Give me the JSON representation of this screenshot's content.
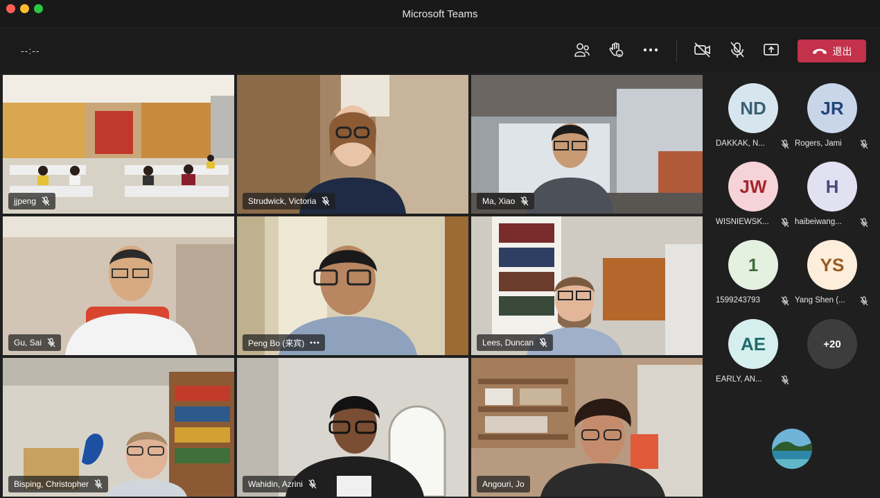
{
  "window": {
    "title": "Microsoft Teams"
  },
  "toolbar": {
    "timer": "--:--",
    "icons": [
      "people-icon",
      "raise-hand-icon",
      "more-icon",
      "camera-off-icon",
      "mic-off-icon",
      "share-screen-icon"
    ],
    "leave_label": "退出",
    "leave_color": "#c4314b"
  },
  "tiles": [
    {
      "name": "jjpeng",
      "muted": true
    },
    {
      "name": "Strudwick, Victoria",
      "muted": true
    },
    {
      "name": "Ma, Xiao",
      "muted": true
    },
    {
      "name": "Gu, Sai",
      "muted": true
    },
    {
      "name": "Peng Bo (来宾)",
      "more": true
    },
    {
      "name": "Lees, Duncan",
      "muted": true
    },
    {
      "name": "Bisping, Christopher",
      "muted": true
    },
    {
      "name": "Wahidin, Azrini",
      "muted": true
    },
    {
      "name": "Angouri, Jo",
      "active": true
    }
  ],
  "roster": [
    {
      "initials": "ND",
      "name": "DAKKAK, N...",
      "bg": "#d7e6ee",
      "fg": "#3b5f73"
    },
    {
      "initials": "JR",
      "name": "Rogers, Jami",
      "bg": "#c9d6ea",
      "fg": "#21457a"
    },
    {
      "initials": "JW",
      "name": "WISNIEWSK...",
      "bg": "#f6d3d8",
      "fg": "#a4262c"
    },
    {
      "initials": "H",
      "name": "haibeiwang...",
      "bg": "#e2e1f2",
      "fg": "#4b4a7a"
    },
    {
      "initials": "1",
      "name": "1599243793",
      "bg": "#e4f1e1",
      "fg": "#3f6b3a"
    },
    {
      "initials": "YS",
      "name": "Yang Shen (...",
      "bg": "#fdeddb",
      "fg": "#9b5a1e"
    },
    {
      "initials": "AE",
      "name": "EARLY, AN...",
      "bg": "#d5efef",
      "fg": "#1e6b6b"
    }
  ],
  "overflow_count": "+20",
  "accent_active": "#9ea2ff"
}
